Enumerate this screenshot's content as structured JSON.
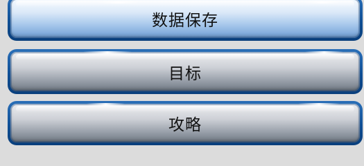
{
  "menu": {
    "items": [
      {
        "label": "数据保存",
        "state": "active"
      },
      {
        "label": "目标",
        "state": "inactive"
      },
      {
        "label": "攻略",
        "state": "inactive"
      }
    ]
  },
  "colors": {
    "frame": "#0f4f95",
    "active_face": "#a9c9ec",
    "inactive_face": "#9aa1ab",
    "text": "#111111",
    "background": "#dcdcdc"
  }
}
